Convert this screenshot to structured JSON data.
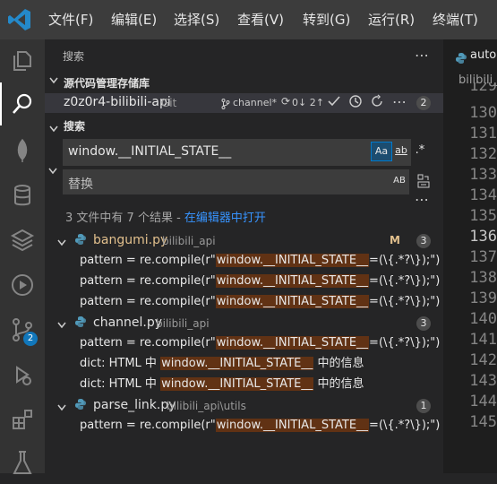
{
  "menu": [
    "文件(F)",
    "编辑(E)",
    "选择(S)",
    "查看(V)",
    "转到(G)",
    "运行(R)",
    "终端(T)"
  ],
  "activity_bar": {
    "items": [
      "explorer-icon",
      "search-icon",
      "mongodb-leaf-icon",
      "database-icon",
      "layers-icon",
      "run-icon",
      "source-control-icon",
      "debug-icon",
      "extensions-icon",
      "flask-icon"
    ],
    "source_control_badge": "2"
  },
  "sidebar": {
    "title": "搜索",
    "scm_section_title": "源代码管理存储库",
    "repo": {
      "name": "z0z0r4-bilibili-api",
      "type": "Git",
      "branch": "channel*",
      "sync": "0↓ 2↑",
      "changes_count": "2"
    },
    "search_section_title": "搜索",
    "search": {
      "query": "window.__INITIAL_STATE__",
      "replace_placeholder": "替换",
      "match_case_label": "Aa",
      "whole_word_label": "ab",
      "regex_label": ".*",
      "preserve_case_label": "AB"
    },
    "results_summary": "3 文件中有 7 个结果 - ",
    "open_in_editor_link": "在编辑器中打开",
    "results": [
      {
        "file": "bangumi.py",
        "path": "bilibili_api",
        "status": "M",
        "count": "3",
        "matches": [
          {
            "pre": "pattern = re.compile(r\"",
            "hit": "window.__INITIAL_STATE__",
            "post": "=(\\{.*?\\});\")"
          },
          {
            "pre": "pattern = re.compile(r\"",
            "hit": "window.__INITIAL_STATE__",
            "post": "=(\\{.*?\\});\")"
          },
          {
            "pre": "pattern = re.compile(r\"",
            "hit": "window.__INITIAL_STATE__",
            "post": "=(\\{.*?\\});\")"
          }
        ]
      },
      {
        "file": "channel.py",
        "path": "bilibili_api",
        "status": "",
        "count": "3",
        "matches": [
          {
            "pre": "pattern = re.compile(r\"",
            "hit": "window.__INITIAL_STATE__",
            "post": "=(\\{.*?\\});\")"
          },
          {
            "pre": "dict: HTML 中 ",
            "hit": "window.__INITIAL_STATE__",
            "post": " 中的信息"
          },
          {
            "pre": "dict: HTML 中 ",
            "hit": "window.__INITIAL_STATE__",
            "post": " 中的信息"
          }
        ]
      },
      {
        "file": "parse_link.py",
        "path": "bilibili_api\\utils",
        "status": "",
        "count": "1",
        "matches": [
          {
            "pre": "pattern = re.compile(r\"",
            "hit": "window.__INITIAL_STATE__",
            "post": "=(\\{.*?\\});\")"
          }
        ]
      }
    ]
  },
  "editor": {
    "tab_label": "auto",
    "breadcrumb": "bilibili_",
    "line_numbers": [
      "129",
      "130",
      "131",
      "132",
      "133",
      "134",
      "135",
      "136",
      "137",
      "138",
      "139",
      "140",
      "141",
      "142",
      "143",
      "144",
      "145"
    ],
    "current_line": "136"
  },
  "colors": {
    "accent": "#007acc",
    "match_highlight": "#613214",
    "modified": "#e2c08d",
    "python_icon": "#519aba"
  }
}
